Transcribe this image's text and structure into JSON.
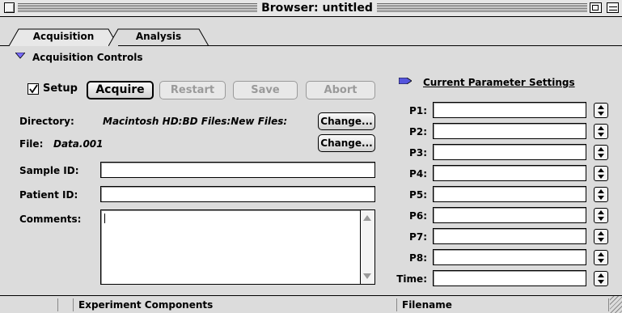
{
  "window": {
    "title": "Browser: untitled"
  },
  "tabs": [
    {
      "label": "Acquisition",
      "active": true
    },
    {
      "label": "Analysis",
      "active": false
    }
  ],
  "acquisition_controls": {
    "header": "Acquisition Controls",
    "setup_label": "Setup",
    "setup_checked": true,
    "buttons": {
      "acquire": "Acquire",
      "restart": "Restart",
      "save": "Save",
      "abort": "Abort"
    },
    "directory_label": "Directory:",
    "directory_value": "Macintosh HD:BD Files:New Files:",
    "file_label": "File:",
    "file_value": "Data.001",
    "change_label": "Change...",
    "sample_id_label": "Sample ID:",
    "sample_id_value": "",
    "patient_id_label": "Patient ID:",
    "patient_id_value": "",
    "comments_label": "Comments:",
    "comments_value": ""
  },
  "parameters": {
    "header": "Current Parameter Settings",
    "rows": [
      {
        "label": "P1:",
        "value": ""
      },
      {
        "label": "P2:",
        "value": ""
      },
      {
        "label": "P3:",
        "value": ""
      },
      {
        "label": "P4:",
        "value": ""
      },
      {
        "label": "P5:",
        "value": ""
      },
      {
        "label": "P6:",
        "value": ""
      },
      {
        "label": "P7:",
        "value": ""
      },
      {
        "label": "P8:",
        "value": ""
      },
      {
        "label": "Time:",
        "value": ""
      }
    ]
  },
  "status_bar": {
    "left": "Experiment Components",
    "right": "Filename"
  },
  "colors": {
    "window_bg": "#dcdcdc",
    "field_bg": "#ffffff",
    "accent": "#5555dd",
    "disabled_text": "#9a9a9a"
  }
}
